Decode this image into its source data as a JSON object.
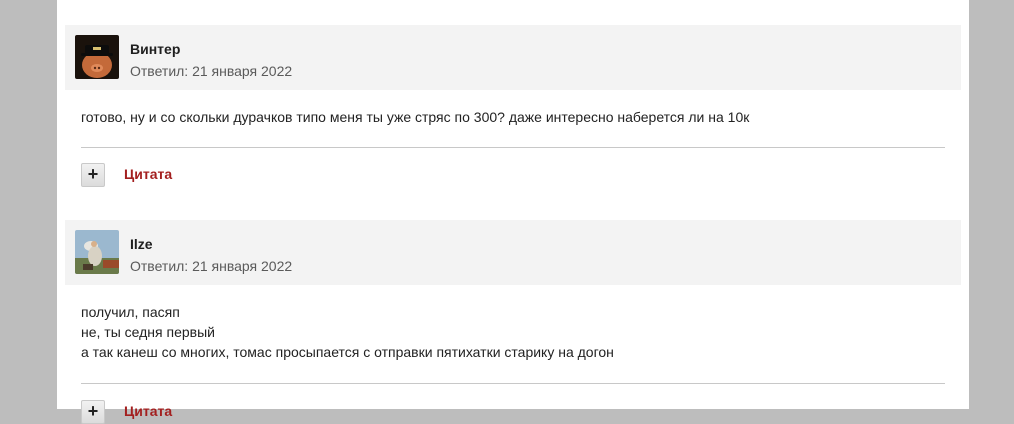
{
  "posts": [
    {
      "author": "Винтер",
      "meta": "Ответил: 21 января 2022",
      "lines": [
        "готово, ну и со скольки дурачков типо меня ты уже стряс по 300? даже интересно наберется ли на 10к"
      ],
      "plus_label": "+",
      "quote_label": "Цитата"
    },
    {
      "author": "Ilze",
      "meta": "Ответил: 21 января 2022",
      "lines": [
        "получил, пасяп",
        "не, ты седня первый",
        "а так канеш со многих, томас просыпается с отправки пятихатки старику на догон"
      ],
      "plus_label": "+",
      "quote_label": "Цитата"
    }
  ],
  "colors": {
    "quote_link": "#a31f1f",
    "header_bg": "#f3f3f3",
    "page_bg": "#bdbdbd"
  }
}
